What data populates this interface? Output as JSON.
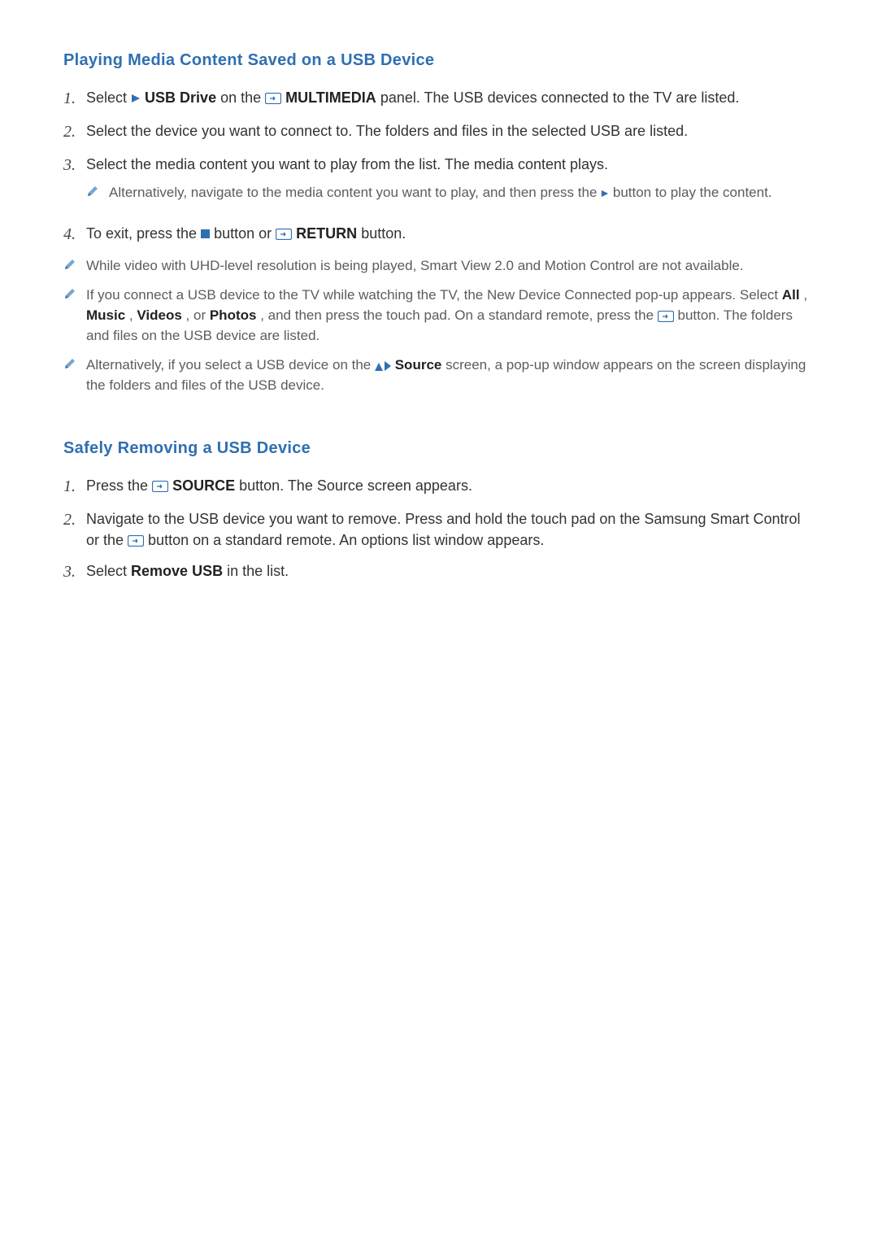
{
  "section1": {
    "title": "Playing Media Content Saved on a USB Device",
    "steps": [
      {
        "num": "1.",
        "pre": "Select ",
        "boldA": "USB Drive",
        "mid1": " on the ",
        "boldB": "MULTIMEDIA",
        "post": " panel. The USB devices connected to the TV are listed."
      },
      {
        "num": "2.",
        "text": "Select the device you want to connect to. The folders and files in the selected USB are listed."
      },
      {
        "num": "3.",
        "text": "Select the media content you want to play from the list. The media content plays.",
        "note": {
          "pre": "Alternatively, navigate to the media content you want to play, and then press the ",
          "post": " button to play the content."
        }
      },
      {
        "num": "4.",
        "pre": "To exit, press the ",
        "mid": " button or ",
        "boldB": "RETURN",
        "post": " button."
      }
    ],
    "notes": [
      {
        "text": "While video with UHD-level resolution is being played, Smart View 2.0 and Motion Control are not available."
      },
      {
        "pre": "If you connect a USB device to the TV while watching the TV, the New Device Connected pop-up appears. Select ",
        "boldA": "All",
        "sepA": ", ",
        "boldB": "Music",
        "sepB": ", ",
        "boldC": "Videos",
        "sepC": ", or ",
        "boldD": "Photos",
        "mid": ", and then press the touch pad. On a standard remote, press the ",
        "post": " button. The folders and files on the USB device are listed."
      },
      {
        "pre": "Alternatively, if you select a USB device on the ",
        "boldA": "Source",
        "post": " screen, a pop-up window appears on the screen displaying the folders and files of the USB device."
      }
    ]
  },
  "section2": {
    "title": "Safely Removing a USB Device",
    "steps": [
      {
        "num": "1.",
        "pre": "Press the ",
        "boldA": "SOURCE",
        "post": " button. The Source screen appears."
      },
      {
        "num": "2.",
        "pre": "Navigate to the USB device you want to remove. Press and hold the touch pad on the Samsung Smart Control or the ",
        "post": " button on a standard remote. An options list window appears."
      },
      {
        "num": "3.",
        "pre": "Select ",
        "boldA": "Remove USB",
        "post": " in the list."
      }
    ]
  }
}
